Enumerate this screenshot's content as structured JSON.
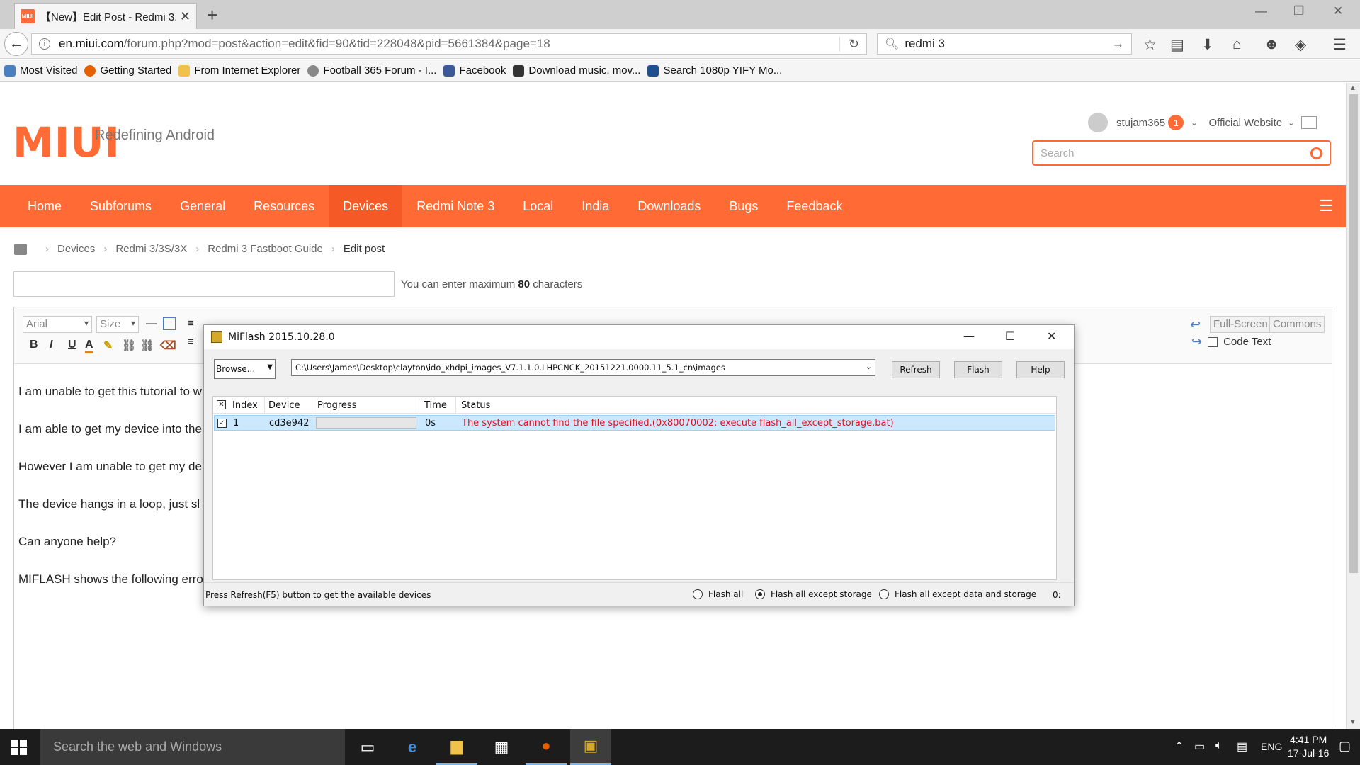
{
  "browser": {
    "tab": {
      "favicon": "MIUI",
      "title": "【New】Edit Post - Redmi 3...",
      "close": "✕"
    },
    "new_tab": "+",
    "window_controls": {
      "minimize": "—",
      "restore": "❐",
      "close": "✕"
    },
    "url": {
      "host": "en.miui.com",
      "path": "/forum.php?mod=post&action=edit&fid=90&tid=228048&pid=5661384&page=18"
    },
    "search_value": "redmi 3",
    "bookmarks": [
      {
        "label": "Most Visited",
        "color": "#4a7fc1"
      },
      {
        "label": "Getting Started",
        "color": "#e66000"
      },
      {
        "label": "From Internet Explorer",
        "color": "#f0c24b"
      },
      {
        "label": "Football 365 Forum - I...",
        "color": "#888888"
      },
      {
        "label": "Facebook",
        "color": "#3b5998"
      },
      {
        "label": "Download music, mov...",
        "color": "#333333"
      },
      {
        "label": "Search 1080p YIFY Mo...",
        "color": "#1e4f8f"
      }
    ]
  },
  "site": {
    "logo": "MIUI",
    "tagline": "Redefining Android",
    "user": {
      "name": "stujam365",
      "notifications": "1",
      "official": "Official Website"
    },
    "search_placeholder": "Search",
    "accent": "#ff6a35",
    "nav": [
      "Home",
      "Subforums",
      "General",
      "Resources",
      "Devices",
      "Redmi Note 3",
      "Local",
      "India",
      "Downloads",
      "Bugs",
      "Feedback"
    ],
    "nav_active": "Devices",
    "breadcrumb": [
      "Devices",
      "Redmi 3/3S/3X",
      "Redmi 3 Fastboot Guide",
      "Edit post"
    ],
    "max_chars": {
      "prefix": "You can enter maximum ",
      "count": "80",
      "suffix": " characters"
    },
    "editor": {
      "font_select": "Arial",
      "size_select": "Size",
      "format_buttons": [
        "B",
        "I",
        "U",
        "A"
      ],
      "fullscreen": "Full-Screen",
      "commons": "Commons",
      "code_text": "Code Text",
      "body_lines": [
        "I am unable to get this tutorial to w",
        "I am able to get my device into the",
        "However I am unable to get my de",
        "The device hangs in a loop, just sl",
        "Can anyone help?",
        "MIFLASH shows the following erro"
      ]
    }
  },
  "miflash": {
    "title": "MiFlash 2015.10.28.0",
    "browse": "Browse...",
    "path": "C:\\Users\\James\\Desktop\\clayton\\ido_xhdpi_images_V7.1.1.0.LHPCNCK_20151221.0000.11_5.1_cn\\images",
    "buttons": {
      "refresh": "Refresh",
      "flash": "Flash",
      "help": "Help"
    },
    "columns": [
      "Index",
      "Device",
      "Progress",
      "Time",
      "Status"
    ],
    "rows": [
      {
        "index": "1",
        "device": "cd3e942",
        "progress": 0,
        "time": "0s",
        "status": "The system cannot find the file specified.(0x80070002: execute flash_all_except_storage.bat)"
      }
    ],
    "status_message": "Press Refresh(F5) button to get the available devices",
    "flash_options": [
      "Flash all",
      "Flash all except storage",
      "Flash all except data and storage"
    ],
    "selected_option": "Flash all except storage",
    "status_tail": "0:"
  },
  "taskbar": {
    "search_placeholder": "Search the web and Windows",
    "language": "ENG",
    "time": "4:41 PM",
    "date": "17-Jul-16"
  }
}
